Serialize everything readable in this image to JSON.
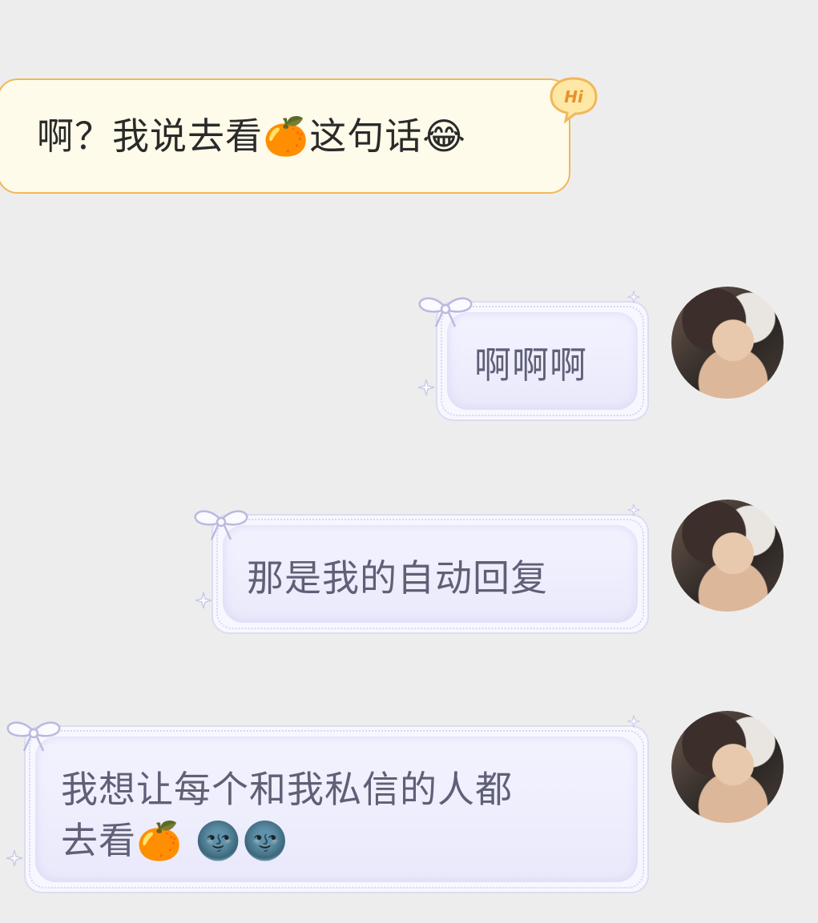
{
  "messages": [
    {
      "direction": "incoming",
      "text_parts": [
        "啊？我说去看",
        "这句话"
      ],
      "emojis": [
        "🍊",
        "😂"
      ],
      "badge": "Hi"
    },
    {
      "direction": "outgoing",
      "text": "啊啊啊"
    },
    {
      "direction": "outgoing",
      "text": "那是我的自动回复"
    },
    {
      "direction": "outgoing",
      "line1": "我想让每个和我私信的人都",
      "line2": "去看",
      "emojis": [
        "🍊",
        "🌚",
        "🌚"
      ]
    }
  ],
  "colors": {
    "incoming_bg": "#fffbea",
    "incoming_border": "#f0b85a",
    "outgoing_bg": "#eeeefc",
    "outgoing_text": "#5f6077",
    "page_bg": "#ededed"
  }
}
